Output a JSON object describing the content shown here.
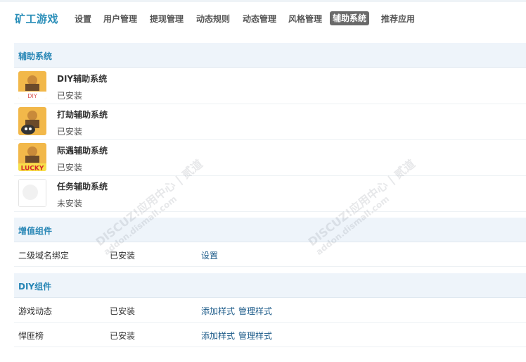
{
  "header": {
    "app_title": "矿工游戏",
    "nav": [
      "设置",
      "用户管理",
      "提现管理",
      "动态规则",
      "动态管理",
      "风格管理",
      "辅助系统",
      "推荐应用"
    ],
    "active_nav": "辅助系统"
  },
  "aux_section": {
    "title": "辅助系统",
    "items": [
      {
        "name": "DIY辅助系统",
        "status": "已安装",
        "icon": "diy-plugin-icon",
        "icon_text": "DIY"
      },
      {
        "name": "打劫辅助系统",
        "status": "已安装",
        "icon": "rob-plugin-icon",
        "icon_text": ""
      },
      {
        "name": "际遇辅助系统",
        "status": "已安装",
        "icon": "lucky-plugin-icon",
        "icon_text": "LUCKY"
      },
      {
        "name": "任务辅助系统",
        "status": "未安装",
        "icon": "task-plugin-icon",
        "icon_text": ""
      }
    ]
  },
  "value_section": {
    "title": "增值组件",
    "rows": [
      {
        "name": "二级域名绑定",
        "status": "已安装",
        "actions": [
          "设置"
        ]
      }
    ]
  },
  "diy_section": {
    "title": "DIY组件",
    "rows": [
      {
        "name": "游戏动态",
        "status": "已安装",
        "actions": [
          "添加样式",
          "管理样式"
        ]
      },
      {
        "name": "悍匪榜",
        "status": "已安装",
        "actions": [
          "添加样式",
          "管理样式"
        ]
      }
    ]
  },
  "watermark": {
    "line1": "DISCUZ!应用中心 | 贰道",
    "line2": "addon.dismall.com"
  },
  "colors": {
    "accent": "#2786b5",
    "link": "#1e5c8a",
    "active_tab_bg": "#6a6a6a",
    "section_bg": "#eef4fa"
  }
}
